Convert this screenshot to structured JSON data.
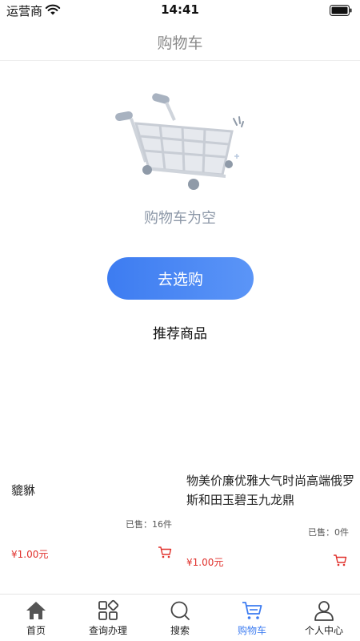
{
  "status_bar": {
    "carrier": "运营商",
    "time": "14:41"
  },
  "header": {
    "title": "购物车"
  },
  "empty_state": {
    "message": "购物车为空",
    "button_label": "去选购"
  },
  "recommend": {
    "title": "推荐商品",
    "products": [
      {
        "name": "貔貅",
        "sold": "已售：16件",
        "price": "¥1.00元"
      },
      {
        "name": "物美价廉优雅大气时尚高端俄罗斯和田玉碧玉九龙鼎",
        "sold": "已售：0件",
        "price": "¥1.00元"
      }
    ]
  },
  "tabs": [
    {
      "label": "首页",
      "icon": "home-icon",
      "active": false
    },
    {
      "label": "查询办理",
      "icon": "grid-icon",
      "active": false
    },
    {
      "label": "搜索",
      "icon": "search-icon",
      "active": false
    },
    {
      "label": "购物车",
      "icon": "cart-icon",
      "active": true
    },
    {
      "label": "个人中心",
      "icon": "user-icon",
      "active": false
    }
  ],
  "colors": {
    "accent": "#3d7cf1",
    "price": "#e0302b",
    "muted": "#8d98a8"
  }
}
